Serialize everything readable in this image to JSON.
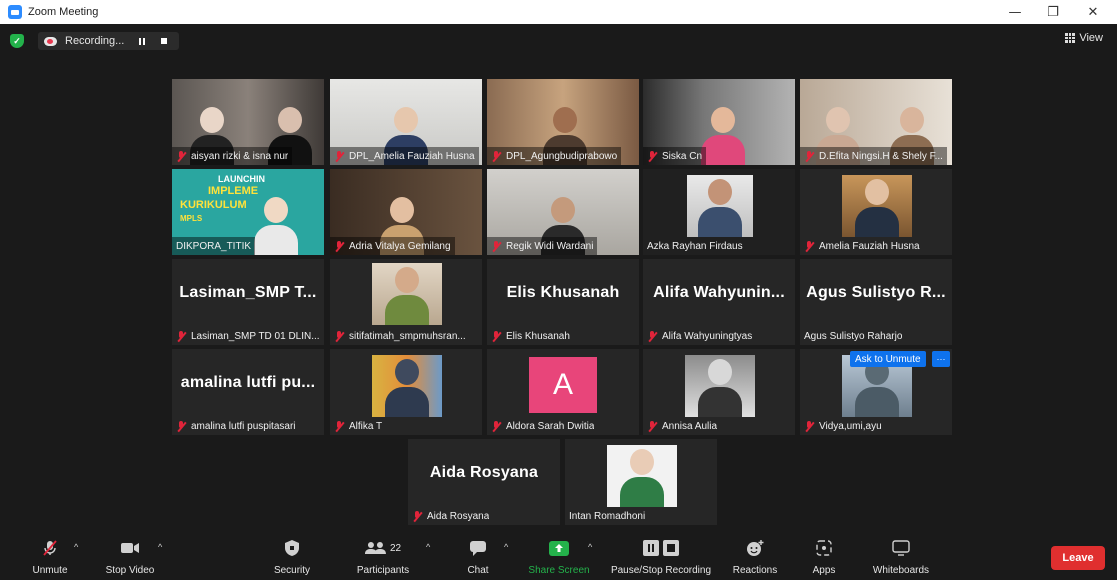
{
  "window": {
    "title": "Zoom Meeting",
    "minimize": "—",
    "restore": "❐",
    "close": "✕"
  },
  "topbar": {
    "recording_label": "Recording...",
    "view_label": "View"
  },
  "tiles": [
    {
      "name": "aisyan rizki & isna nur",
      "muted": true,
      "video": true
    },
    {
      "name": "DPL_Amelia Fauziah Husna",
      "muted": true,
      "video": true
    },
    {
      "name": "DPL_Agungbudiprabowo",
      "muted": true,
      "video": true
    },
    {
      "name": "Siska Cn",
      "muted": true,
      "video": true
    },
    {
      "name": "D.Efita Ningsi.H & Shely F...",
      "muted": true,
      "video": true
    },
    {
      "name": "DIKPORA_TITIK",
      "muted": false,
      "video": true,
      "banner_line1": "LAUNCHIN",
      "banner_line2": "IMPLEME",
      "banner_line3": "KURIKULUM",
      "banner_line4": "MPLS"
    },
    {
      "name": "Adria Vitalya Gemilang",
      "muted": true,
      "video": true
    },
    {
      "name": "Regik Widi Wardani",
      "muted": true,
      "video": true
    },
    {
      "name": "Azka Rayhan Firdaus",
      "muted": false,
      "video": true,
      "active": true
    },
    {
      "name": "Amelia Fauziah Husna",
      "muted": true,
      "video": true
    },
    {
      "name": "Lasiman_SMP TD 01 DLIN...",
      "display": "Lasiman_SMP T...",
      "muted": true,
      "video": false
    },
    {
      "name": "sitifatimah_smpmuhsran...",
      "muted": true,
      "video": true
    },
    {
      "name": "Elis Khusanah",
      "display": "Elis Khusanah",
      "muted": true,
      "video": false
    },
    {
      "name": "Alifa Wahyuningtyas",
      "display": "Alifa Wahyunin...",
      "muted": true,
      "video": false
    },
    {
      "name": "Agus Sulistyo Raharjo",
      "display": "Agus Sulistyo R...",
      "muted": false,
      "video": false
    },
    {
      "name": "amalina lutfi puspitasari",
      "display": "amalina lutfi pu...",
      "muted": true,
      "video": false
    },
    {
      "name": "Alfika T",
      "muted": true,
      "video": true
    },
    {
      "name": "Aldora Sarah Dwitia",
      "muted": true,
      "video": false,
      "avatar_letter": "A"
    },
    {
      "name": "Annisa Aulia",
      "muted": true,
      "video": true
    },
    {
      "name": "Vidya,umi,ayu",
      "muted": true,
      "video": true,
      "ask_unmute": "Ask to Unmute",
      "more": "···"
    },
    {
      "name": "Aida Rosyana",
      "display": "Aida Rosyana",
      "muted": true,
      "video": false
    },
    {
      "name": "Intan Romadhoni",
      "muted": false,
      "video": true
    }
  ],
  "toolbar": {
    "unmute": "Unmute",
    "stop_video": "Stop Video",
    "security": "Security",
    "participants": "Participants",
    "participants_count": "22",
    "chat": "Chat",
    "share_screen": "Share Screen",
    "pause_stop_recording": "Pause/Stop Recording",
    "reactions": "Reactions",
    "apps": "Apps",
    "whiteboards": "Whiteboards",
    "leave": "Leave",
    "caret": "^"
  },
  "colors": {
    "accent": "#0e72ed",
    "active_speaker": "#d9e26a",
    "leave": "#e02f2f",
    "share": "#24b24b",
    "muted": "#e0243a"
  }
}
